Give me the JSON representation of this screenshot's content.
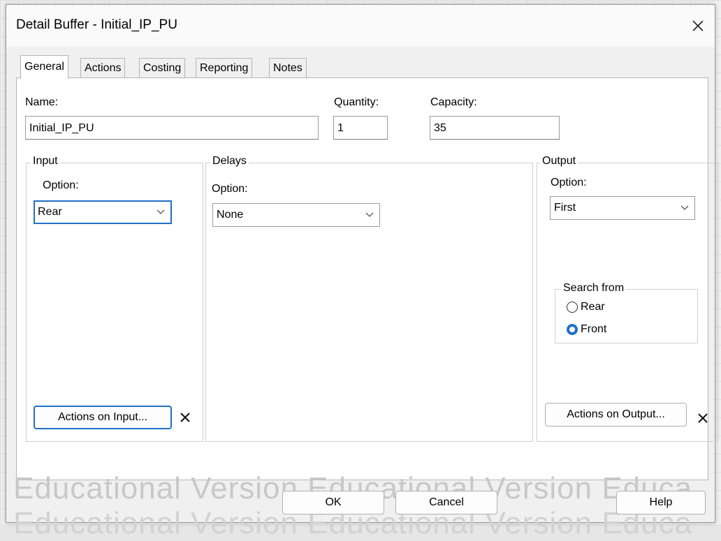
{
  "window": {
    "title": "Detail Buffer - Initial_IP_PU",
    "close_glyph": "✕"
  },
  "watermark": {
    "line1": "Educational Version Educational Version Educa",
    "line2": "Educational Version Educational Version Educa"
  },
  "tabs": [
    "General",
    "Actions",
    "Costing",
    "Reporting",
    "Notes"
  ],
  "general": {
    "name_label": "Name:",
    "name_value": "Initial_IP_PU",
    "quantity_label": "Quantity:",
    "quantity_value": "1",
    "capacity_label": "Capacity:",
    "capacity_value": "35"
  },
  "input": {
    "title": "Input",
    "option_label": "Option:",
    "option_value": "Rear",
    "actions_label": "Actions on Input...",
    "x_glyph": "✕"
  },
  "delays": {
    "title": "Delays",
    "option_label": "Option:",
    "option_value": "None"
  },
  "output": {
    "title": "Output",
    "option_label": "Option:",
    "option_value": "First",
    "search_title": "Search from",
    "search_rear": "Rear",
    "search_front": "Front",
    "selected": "Front",
    "actions_label": "Actions on Output...",
    "x_glyph": "✕"
  },
  "footer": {
    "ok": "OK",
    "cancel": "Cancel",
    "help": "Help"
  },
  "colors": {
    "accent": "#1f70c7"
  },
  "icons": {
    "chevron": "chevron-down-icon",
    "close": "close-icon"
  }
}
